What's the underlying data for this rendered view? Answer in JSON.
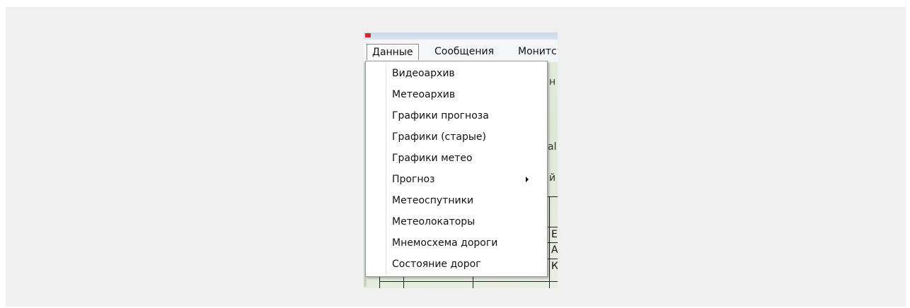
{
  "menubar": {
    "items": [
      {
        "label": "Данные"
      },
      {
        "label": "Сообщения"
      },
      {
        "label": "Монитс"
      }
    ]
  },
  "dropdown": {
    "items": [
      {
        "label": "Видеоархив"
      },
      {
        "label": "Метеоархив"
      },
      {
        "label": "Графики прогноза"
      },
      {
        "label": "Графики (старые)"
      },
      {
        "label": "Графики метео"
      },
      {
        "label": "Прогноз",
        "has_submenu": true
      },
      {
        "label": "Метеоспутники"
      },
      {
        "label": "Метеолокаторы"
      },
      {
        "label": "Мнемосхема дороги"
      },
      {
        "label": "Состояние дорог"
      }
    ]
  },
  "background": {
    "fragments": [
      "н",
      "аl",
      "й",
      "Е",
      "А",
      "К"
    ]
  },
  "colors": {
    "menu_bg": "#ffffff",
    "menu_border": "#9a9a9a",
    "titlebar": "#c9d7ea",
    "map": "#dfe8d6"
  }
}
